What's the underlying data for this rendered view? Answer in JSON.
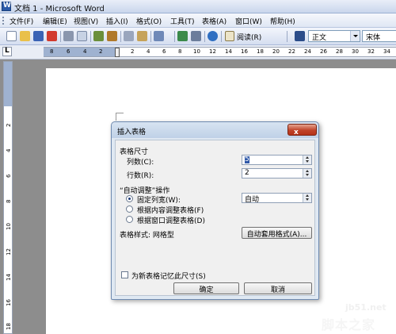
{
  "window": {
    "title": "文档 1 - Microsoft Word"
  },
  "menu": [
    "文件(F)",
    "编辑(E)",
    "视图(V)",
    "插入(I)",
    "格式(O)",
    "工具(T)",
    "表格(A)",
    "窗口(W)",
    "帮助(H)"
  ],
  "toolbar": {
    "read_label": "阅读(R)",
    "style_value": "正文",
    "font_value": "宋体"
  },
  "ruler": {
    "top_numbers": [
      "8",
      "6",
      "4",
      "2",
      "2",
      "4",
      "6",
      "8",
      "10",
      "12",
      "14",
      "16",
      "18",
      "20",
      "22",
      "24",
      "26",
      "28",
      "30",
      "32",
      "34"
    ],
    "left_numbers": [
      "2",
      "4",
      "6",
      "8",
      "10",
      "12",
      "14",
      "16",
      "18"
    ]
  },
  "dialog": {
    "title": "插入表格",
    "close_label": "x",
    "size_group": "表格尺寸",
    "columns_label": "列数(C):",
    "columns_value": "5",
    "rows_label": "行数(R):",
    "rows_value": "2",
    "autofit_group": "“自动调整”操作",
    "fixed_width_label": "固定列宽(W):",
    "fixed_width_value": "自动",
    "fit_content_label": "根据内容调整表格(F)",
    "fit_window_label": "根据窗口调整表格(D)",
    "table_style_label": "表格样式: 网格型",
    "autoformat_button": "自动套用格式(A)...",
    "remember_label": "为新表格记忆此尺寸(S)",
    "ok_button": "确定",
    "cancel_button": "取消"
  },
  "watermark": {
    "site": "jb51.net",
    "name": "脚本之家"
  },
  "colors": {
    "accent": "#2f58a8",
    "close": "#c0442a"
  }
}
